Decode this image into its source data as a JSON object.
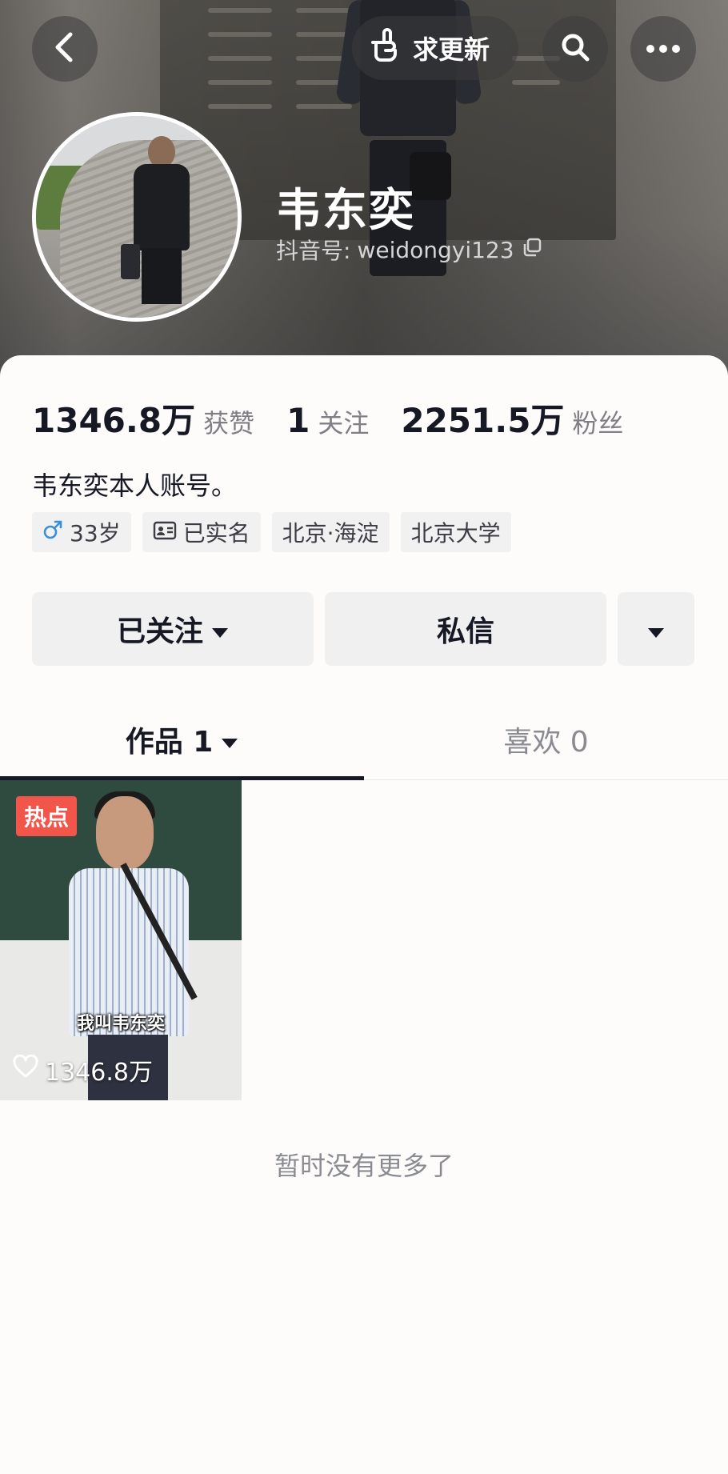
{
  "header": {
    "request_update_label": "求更新",
    "name": "韦东奕",
    "douyin_id_label": "抖音号:",
    "douyin_id": "weidongyi123"
  },
  "stats": {
    "likes": {
      "value": "1346.8万",
      "label": "获赞"
    },
    "following": {
      "value": "1",
      "label": "关注"
    },
    "followers": {
      "value": "2251.5万",
      "label": "粉丝"
    }
  },
  "bio": "韦东奕本人账号。",
  "tags": {
    "age": "33岁",
    "verified": "已实名",
    "location": "北京·海淀",
    "school": "北京大学"
  },
  "actions": {
    "followed_label": "已关注",
    "message_label": "私信"
  },
  "tabs": {
    "works_label": "作品 1",
    "likes_label": "喜欢 0"
  },
  "video": {
    "badge": "热点",
    "caption": "我叫韦东奕",
    "like_count": "1346.8万"
  },
  "footer_note": "暂时没有更多了",
  "colors": {
    "accent": "#161823",
    "hot_badge": "#f2554a",
    "male_icon": "#3a8fd9"
  },
  "icons": [
    "back-icon",
    "hand-pointer-icon",
    "search-icon",
    "more-icon",
    "copy-icon",
    "male-icon",
    "id-card-icon",
    "caret-down-icon",
    "heart-icon"
  ]
}
